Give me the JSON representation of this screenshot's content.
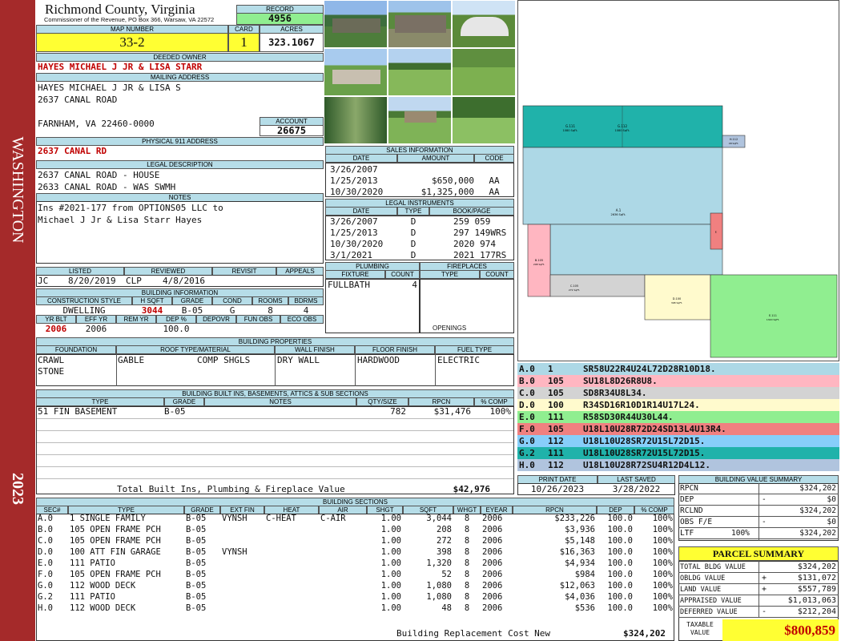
{
  "header": {
    "county": "Richmond County, Virginia",
    "commissioner": "Commissioner of the Revenue, PO Box 366, Warsaw, VA 22572",
    "record_label": "RECORD",
    "record": "4956",
    "map_label": "MAP NUMBER",
    "map_number": "33-2",
    "card_label": "CARD",
    "card": "1",
    "acres_label": "ACRES",
    "acres": "323.1067"
  },
  "side": {
    "district": "WASHINGTON",
    "year": "2023"
  },
  "owner": {
    "deeded_label": "DEEDED OWNER",
    "deeded_owner": "HAYES MICHAEL J JR & LISA STARR",
    "mailing_label": "MAILING ADDRESS",
    "mailing_lines": [
      "HAYES MICHAEL J JR & LISA S",
      "2637 CANAL ROAD",
      "",
      "FARNHAM, VA 22460-0000"
    ],
    "account_label": "ACCOUNT",
    "account": "26675",
    "physical_label": "PHYSICAL 911 ADDRESS",
    "physical": "2637 CANAL RD",
    "legal_label": "LEGAL DESCRIPTION",
    "legal_lines": [
      "2637 CANAL ROAD - HOUSE",
      "2633 CANAL ROAD - WAS SWMH"
    ],
    "notes_label": "NOTES",
    "notes_lines": [
      "Ins #2021-177 from OPTIONS05 LLC to",
      "Michael J Jr & Lisa Starr Hayes"
    ]
  },
  "review": {
    "labels": [
      "LISTED",
      "REVIEWED",
      "REVISIT",
      "APPEALS"
    ],
    "listed_by": "JC",
    "listed_date": "8/20/2019",
    "reviewed_by": "CLP",
    "reviewed_date": "4/8/2016"
  },
  "building_info": {
    "label": "BUILDING INFORMATION",
    "headers1": [
      "CONSTRUCTION STYLE",
      "H SQFT",
      "GRADE",
      "COND",
      "ROOMS",
      "BDRMS"
    ],
    "values1": [
      "DWELLING",
      "3044",
      "B-05",
      "G",
      "8",
      "4"
    ],
    "headers2": [
      "YR BLT",
      "EFF YR",
      "REM YR",
      "DEP %",
      "DEPOVR",
      "FUN OBS",
      "ECO OBS"
    ],
    "values2": [
      "2006",
      "2006",
      "",
      "100.0",
      "",
      "",
      ""
    ]
  },
  "sales": {
    "label": "SALES INFORMATION",
    "headers": [
      "DATE",
      "AMOUNT",
      "CODE"
    ],
    "rows": [
      [
        "3/26/2007",
        "",
        ""
      ],
      [
        "1/25/2013",
        "$650,000",
        "AA"
      ],
      [
        "10/30/2020",
        "$1,325,000",
        "AA"
      ]
    ]
  },
  "instruments": {
    "label": "LEGAL INSTRUMENTS",
    "headers": [
      "DATE",
      "TYPE",
      "BOOK/PAGE"
    ],
    "rows": [
      [
        "3/26/2007",
        "D",
        "259 059"
      ],
      [
        "1/25/2013",
        "D",
        "297 149WRS"
      ],
      [
        "10/30/2020",
        "D",
        "2020 974"
      ],
      [
        "3/1/2021",
        "D",
        "2021 177RS"
      ]
    ]
  },
  "plumbing": {
    "label": "PLUMBING",
    "headers": [
      "FIXTURE",
      "COUNT"
    ],
    "fixture": "FULLBATH",
    "count": "4"
  },
  "fireplaces": {
    "label": "FIREPLACES",
    "headers": [
      "TYPE",
      "COUNT"
    ],
    "openings_label": "OPENINGS"
  },
  "properties": {
    "label": "BUILDING PROPERTIES",
    "headers": [
      "FOUNDATION",
      "ROOF TYPE/MATERIAL",
      "WALL FINISH",
      "FLOOR FINISH",
      "FUEL TYPE"
    ],
    "foundation": [
      "CRAWL",
      "STONE"
    ],
    "roof_type": "GABLE",
    "roof_material": "COMP SHGLS",
    "wall": "DRY WALL",
    "floor": "HARDWOOD",
    "fuel": "ELECTRIC"
  },
  "builtins": {
    "label": "BUILDING BUILT INS, BASEMENTS, ATTICS & SUB SECTIONS",
    "headers": [
      "TYPE",
      "GRADE",
      "NOTES",
      "QTY/SIZE",
      "RPCN",
      "% COMP"
    ],
    "row": [
      "51 FIN BASEMENT",
      "B-05",
      "",
      "782",
      "$31,476",
      "100%"
    ],
    "total_label": "Total Built Ins, Plumbing & Fireplace Value",
    "total": "$42,976"
  },
  "sketch": {
    "sections": [
      {
        "code": "A.0",
        "num": "1",
        "text": "SR58U22R4U24L72D28R10D18.",
        "color": "#add8e6"
      },
      {
        "code": "B.0",
        "num": "105",
        "text": "SU18L8D26R8U8.",
        "color": "#ffb6c1"
      },
      {
        "code": "C.0",
        "num": "105",
        "text": "SD8R34U8L34.",
        "color": "#d3d3d3"
      },
      {
        "code": "D.0",
        "num": "100",
        "text": "R34SD16R10D1R14U17L24.",
        "color": "#fffacd"
      },
      {
        "code": "E.0",
        "num": "111",
        "text": "R58SD30R44U30L44.",
        "color": "#90ee90"
      },
      {
        "code": "F.0",
        "num": "105",
        "text": "U18L10U28R72D24SD13L4U13R4.",
        "color": "#f08080"
      },
      {
        "code": "G.0",
        "num": "112",
        "text": "U18L10U28SR72U15L72D15.",
        "color": "#87cefa"
      },
      {
        "code": "G.2",
        "num": "111",
        "text": "U18L10U28SR72U15L72D15.",
        "color": "#20b2aa"
      },
      {
        "code": "H.0",
        "num": "112",
        "text": "U18L10U28R72SU4R12D4L12.",
        "color": "#b0c4de"
      }
    ],
    "areas": {
      "g0": "G.112\n1080 SqFt.",
      "g2": "G.111\n1080 SqFt.",
      "h0": "H.112\n48 SqFt.",
      "a0": "A.1\n2636 SqFt.",
      "b0": "B.105\n208 SqFt.",
      "c0": "C.105\n272 SqFt.",
      "d0": "D.100\n398 SqFt.",
      "e0": "E.111\n1320 SqFt.",
      "f0": "F."
    }
  },
  "dates": {
    "print_label": "PRINT DATE",
    "print": "10/26/2023",
    "saved_label": "LAST SAVED",
    "saved": "3/28/2022"
  },
  "value_summary": {
    "label": "BUILDING VALUE SUMMARY",
    "rows": [
      {
        "k": "RPCN",
        "s": "",
        "v": "$324,202"
      },
      {
        "k": "DEP",
        "s": "-",
        "v": "$0"
      },
      {
        "k": "RCLND",
        "s": "",
        "v": "$324,202"
      },
      {
        "k": "OBS F/E",
        "s": "-",
        "v": "$0"
      },
      {
        "k": "LTF",
        "s": "100%",
        "v": "$324,202"
      }
    ]
  },
  "parcel": {
    "label": "PARCEL SUMMARY",
    "rows": [
      {
        "k": "TOTAL BLDG VALUE",
        "s": "",
        "v": "$324,202"
      },
      {
        "k": "OBLDG VALUE",
        "s": "+",
        "v": "$131,072"
      },
      {
        "k": "LAND VALUE",
        "s": "+",
        "v": "$557,789"
      },
      {
        "k": "APPRAISED VALUE",
        "s": "",
        "v": "$1,013,063"
      },
      {
        "k": "DEFERRED VALUE",
        "s": "-",
        "v": "$212,204"
      }
    ],
    "taxable_label": "TAXABLE VALUE",
    "taxable": "$800,859"
  },
  "sections": {
    "label": "BUILDING SECTIONS",
    "headers": [
      "SEC#",
      "TYPE",
      "GRADE",
      "EXT FIN",
      "HEAT",
      "AIR",
      "SHGT",
      "SQFT",
      "WHGT",
      "EYEAR",
      "RPCN",
      "DEP",
      "% COMP"
    ],
    "rows": [
      [
        "A.0",
        "1 SINGLE FAMILY",
        "B-05",
        "VYNSH",
        "C-HEAT",
        "C-AIR",
        "1.00",
        "3,044",
        "8",
        "2006",
        "$233,226",
        "100.0",
        "100%"
      ],
      [
        "B.0",
        "105 OPEN FRAME PCH",
        "B-05",
        "",
        "",
        "",
        "1.00",
        "208",
        "8",
        "2006",
        "$3,936",
        "100.0",
        "100%"
      ],
      [
        "C.0",
        "105 OPEN FRAME PCH",
        "B-05",
        "",
        "",
        "",
        "1.00",
        "272",
        "8",
        "2006",
        "$5,148",
        "100.0",
        "100%"
      ],
      [
        "D.0",
        "100 ATT FIN GARAGE",
        "B-05",
        "VYNSH",
        "",
        "",
        "1.00",
        "398",
        "8",
        "2006",
        "$16,363",
        "100.0",
        "100%"
      ],
      [
        "E.0",
        "111 PATIO",
        "B-05",
        "",
        "",
        "",
        "1.00",
        "1,320",
        "8",
        "2006",
        "$4,934",
        "100.0",
        "100%"
      ],
      [
        "F.0",
        "105 OPEN FRAME PCH",
        "B-05",
        "",
        "",
        "",
        "1.00",
        "52",
        "8",
        "2006",
        "$984",
        "100.0",
        "100%"
      ],
      [
        "G.0",
        "112 WOOD DECK",
        "B-05",
        "",
        "",
        "",
        "1.00",
        "1,080",
        "8",
        "2006",
        "$12,063",
        "100.0",
        "100%"
      ],
      [
        "G.2",
        "111 PATIO",
        "B-05",
        "",
        "",
        "",
        "1.00",
        "1,080",
        "8",
        "2006",
        "$4,036",
        "100.0",
        "100%"
      ],
      [
        "H.0",
        "112 WOOD DECK",
        "B-05",
        "",
        "",
        "",
        "1.00",
        "48",
        "8",
        "2006",
        "$536",
        "100.0",
        "100%"
      ]
    ],
    "total_label": "Building Replacement Cost New",
    "total": "$324,202"
  }
}
